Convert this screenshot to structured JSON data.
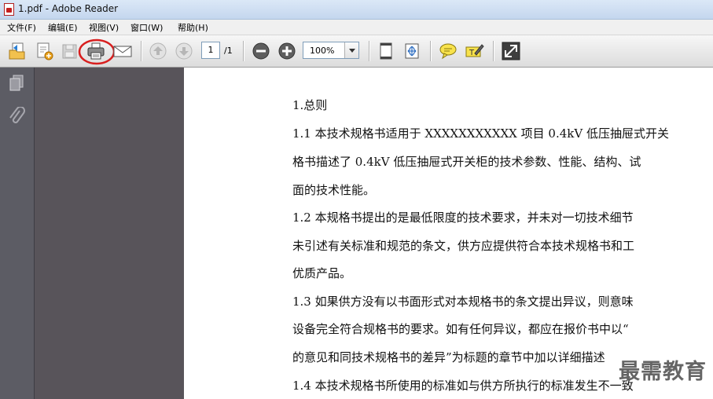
{
  "window": {
    "title": "1.pdf - Adobe Reader"
  },
  "menu": {
    "items": [
      "文件(F)",
      "编辑(E)",
      "视图(V)",
      "窗口(W)",
      "帮助(H)"
    ]
  },
  "toolbar": {
    "page_current": "1",
    "page_total": "/1",
    "zoom": "100%"
  },
  "highlight": {
    "circled": "print-button",
    "color": "#d81e1e"
  },
  "document": {
    "lines": [
      "1.总则",
      "1.1 本技术规格书适用于 XXXXXXXXXXX 项目 0.4kV 低压抽屉式开关",
      "格书描述了 0.4kV 低压抽屉式开关柜的技术参数、性能、结构、试",
      "面的技术性能。",
      "1.2 本规格书提出的是最低限度的技术要求，并未对一切技术细节",
      "未引述有关标准和规范的条文，供方应提供符合本技术规格书和工",
      "优质产品。",
      "1.3 如果供方没有以书面形式对本规格书的条文提出异议，则意味",
      "设备完全符合规格书的要求。如有任何异议，都应在报价书中以“",
      "的意见和同技术规格书的差异”为标题的章节中加以详细描述",
      "1.4 本技术规格书所使用的标准如与供方所执行的标准发生不一致"
    ]
  },
  "watermark": "最需教育"
}
